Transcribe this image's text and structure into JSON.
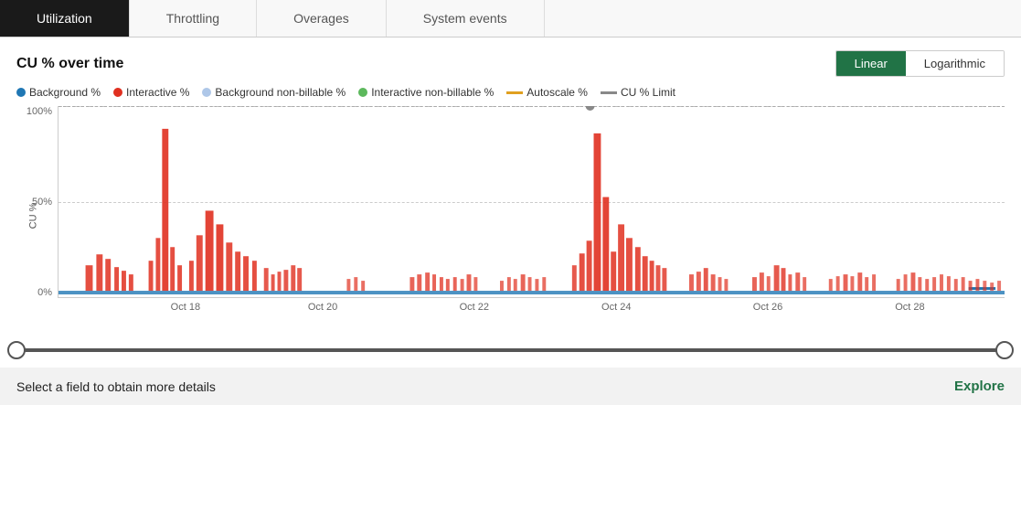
{
  "tabs": [
    {
      "label": "Utilization",
      "active": true
    },
    {
      "label": "Throttling",
      "active": false
    },
    {
      "label": "Overages",
      "active": false
    },
    {
      "label": "System events",
      "active": false
    }
  ],
  "chart": {
    "title": "CU % over time",
    "scale_linear_label": "Linear",
    "scale_logarithmic_label": "Logarithmic",
    "y_axis_label": "CU %",
    "y_ticks": [
      "100%",
      "50%",
      "0%"
    ],
    "x_labels": [
      "Oct 18",
      "Oct 20",
      "Oct 22",
      "Oct 24",
      "Oct 26",
      "Oct 28"
    ],
    "legend": [
      {
        "label": "Background %",
        "type": "dot",
        "color": "#1f77b4"
      },
      {
        "label": "Interactive %",
        "type": "dot",
        "color": "#e03020"
      },
      {
        "label": "Background non-billable %",
        "type": "dot",
        "color": "#aec7e8"
      },
      {
        "label": "Interactive non-billable %",
        "type": "dot",
        "color": "#5cb85c"
      },
      {
        "label": "Autoscale %",
        "type": "dash",
        "color": "#e0a020"
      },
      {
        "label": "CU % Limit",
        "type": "dash",
        "color": "#888888"
      }
    ]
  },
  "slider": {
    "left_pct": 0,
    "right_pct": 100
  },
  "bottom": {
    "text": "Select a field to obtain more details",
    "explore_label": "Explore"
  }
}
